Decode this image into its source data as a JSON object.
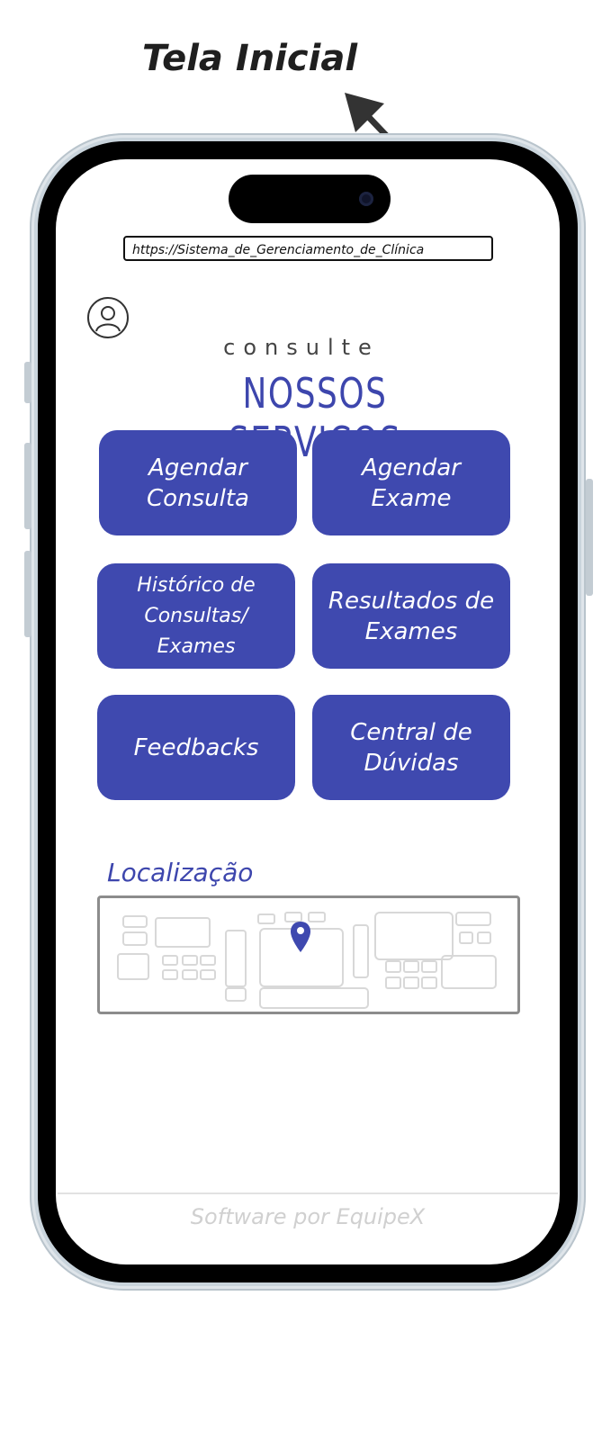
{
  "annotation": {
    "heading": "Tela Inicial"
  },
  "browser": {
    "url": "https://Sistema_de_Gerenciamento_de_Clínica"
  },
  "header": {
    "subtitle": "consulte",
    "title": "NOSSOS SERVIÇOS",
    "avatar_icon": "user-avatar-icon"
  },
  "services": [
    {
      "id": "agendar-consulta",
      "label": "Agendar\nConsulta"
    },
    {
      "id": "agendar-exame",
      "label": "Agendar\nExame"
    },
    {
      "id": "historico",
      "label": "Histórico de\nConsultas/ Exames"
    },
    {
      "id": "resultados",
      "label": "Resultados de\nExames"
    },
    {
      "id": "feedbacks",
      "label": "Feedbacks"
    },
    {
      "id": "central-duvidas",
      "label": "Central de\nDúvidas"
    }
  ],
  "location": {
    "label": "Localização",
    "pin_icon": "map-pin-icon"
  },
  "footer": {
    "text": "Software por EquipeX"
  },
  "colors": {
    "accent": "#3f49af",
    "title_text": "#3d46ad",
    "bezel": "#000000",
    "frame": "#dfe5ea"
  }
}
